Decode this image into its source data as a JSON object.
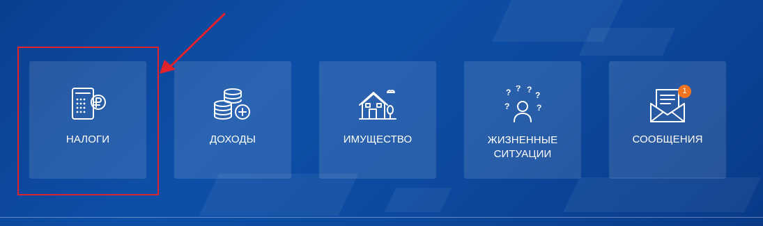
{
  "tiles": [
    {
      "label": "НАЛОГИ",
      "icon": "calculator-ruble-icon"
    },
    {
      "label": "ДОХОДЫ",
      "icon": "coins-plus-icon"
    },
    {
      "label": "ИМУЩЕСТВО",
      "icon": "house-icon"
    },
    {
      "label_line1": "ЖИЗНЕННЫЕ",
      "label_line2": "СИТУАЦИИ",
      "icon": "person-questions-icon"
    },
    {
      "label": "СООБЩЕНИЯ",
      "icon": "envelope-letter-icon",
      "badge": "1"
    }
  ],
  "colors": {
    "background": "#0c4aa0",
    "tile": "rgba(255,255,255,0.12)",
    "highlight": "#e0222c",
    "badge": "#f07320"
  }
}
